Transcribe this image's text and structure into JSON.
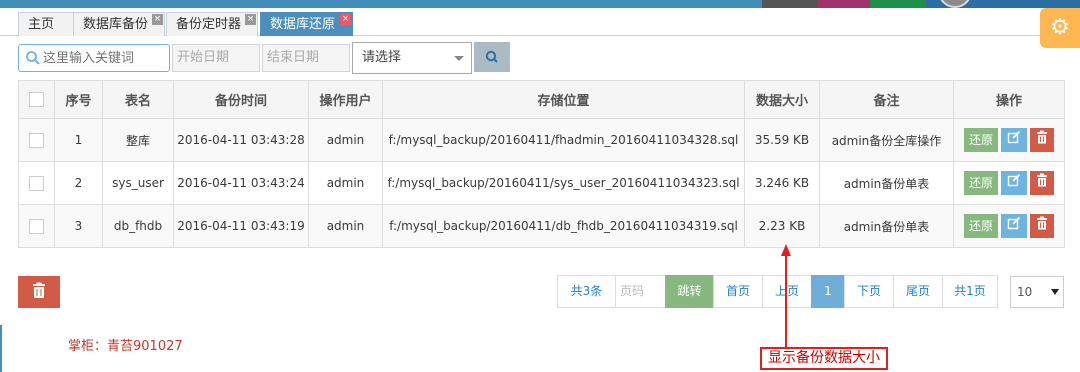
{
  "tabs": [
    {
      "label": "主页",
      "closable": false,
      "active": false
    },
    {
      "label": "数据库备份",
      "closable": true,
      "active": false
    },
    {
      "label": "备份定时器",
      "closable": true,
      "active": false
    },
    {
      "label": "数据库还原",
      "closable": true,
      "active": true
    }
  ],
  "toolbar": {
    "search_placeholder": "这里输入关键词",
    "start_date_placeholder": "开始日期",
    "end_date_placeholder": "结束日期",
    "select_value": "请选择"
  },
  "table": {
    "columns": [
      "序号",
      "表名",
      "备份时间",
      "操作用户",
      "存储位置",
      "数据大小",
      "备注",
      "操作"
    ],
    "rows": [
      {
        "no": "1",
        "name": "整库",
        "time": "2016-04-11 03:43:28",
        "user": "admin",
        "path": "f:/mysql_backup/20160411/fhadmin_20160411034328.sql",
        "size": "35.59 KB",
        "note": "admin备份全库操作"
      },
      {
        "no": "2",
        "name": "sys_user",
        "time": "2016-04-11 03:43:24",
        "user": "admin",
        "path": "f:/mysql_backup/20160411/sys_user_20160411034323.sql",
        "size": "3.246 KB",
        "note": "admin备份单表"
      },
      {
        "no": "3",
        "name": "db_fhdb",
        "time": "2016-04-11 03:43:19",
        "user": "admin",
        "path": "f:/mysql_backup/20160411/db_fhdb_20160411034319.sql",
        "size": "2.23 KB",
        "note": "admin备份单表"
      }
    ],
    "restore_label": "还原"
  },
  "pager": {
    "total_records": "共3条",
    "page_input_placeholder": "页码",
    "go": "跳转",
    "first": "首页",
    "prev": "上页",
    "current": "1",
    "next": "下页",
    "last": "尾页",
    "total_pages": "共1页",
    "page_size": "10"
  },
  "footer_note": "掌柜：青苔901027",
  "annotation": "显示备份数据大小",
  "colors": {
    "accent": "#438eb9",
    "success": "#87b87f",
    "info": "#6fb3e0",
    "danger": "#d15b47",
    "settings": "#ffb752",
    "annotation_red": "#e02020"
  }
}
